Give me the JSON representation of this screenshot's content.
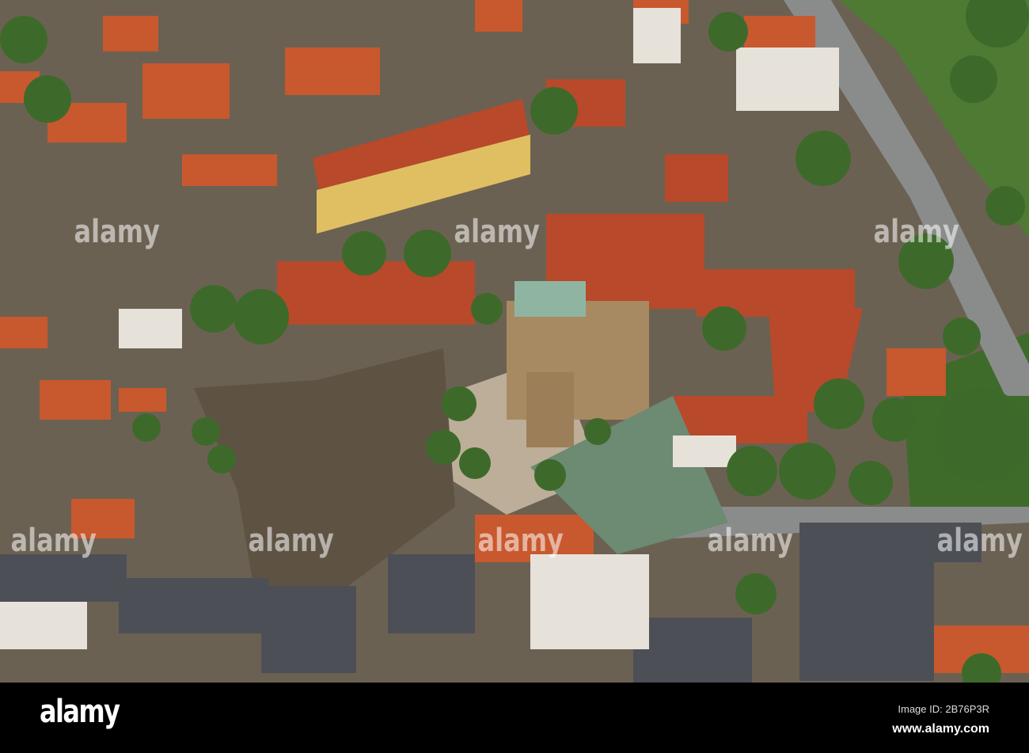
{
  "photo": {
    "subject": "aerial view of city centre with cathedral"
  },
  "watermark": {
    "text": "alamy",
    "wide": "alamy   alamy   alamy   alamy"
  },
  "footer": {
    "logo": "alamy",
    "image_id": "Image ID: 2B76P3R",
    "website": "www.alamy.com"
  }
}
